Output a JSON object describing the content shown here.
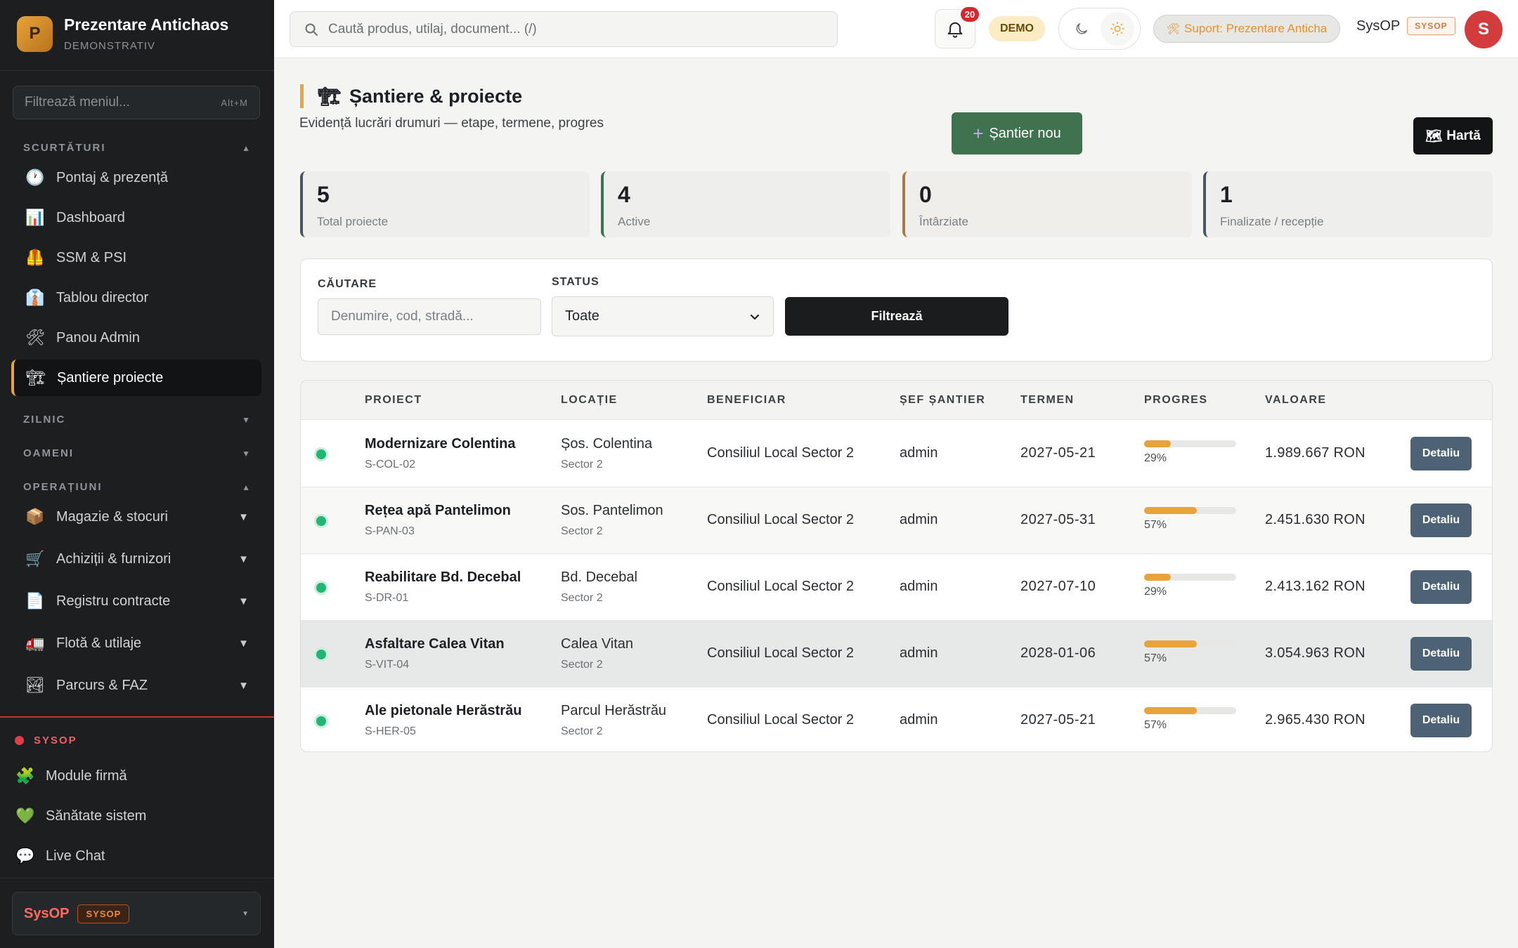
{
  "brand": {
    "logo_letter": "P",
    "name": "Prezentare Antichaos",
    "subtitle": "DEMONSTRATIV"
  },
  "sidebar": {
    "filter_placeholder": "Filtrează meniul...",
    "filter_shortcut": "Alt+M",
    "sections": {
      "shortcuts": "SCURTĂTURI",
      "daily": "ZILNIC",
      "people": "OAMENI",
      "operations": "OPERAȚIUNI"
    },
    "shortcut_items": [
      {
        "label": "Pontaj & prezență",
        "icon": "clock-icon"
      },
      {
        "label": "Dashboard",
        "icon": "bar-chart-icon"
      },
      {
        "label": "SSM & PSI",
        "icon": "safety-vest-icon"
      },
      {
        "label": "Tablou director",
        "icon": "director-icon"
      },
      {
        "label": "Panou Admin",
        "icon": "tools-icon"
      },
      {
        "label": "Șantiere proiecte",
        "icon": "construction-icon"
      }
    ],
    "operation_items": [
      {
        "label": "Magazie & stocuri",
        "icon": "package-icon"
      },
      {
        "label": "Achiziții & furnizori",
        "icon": "cart-icon"
      },
      {
        "label": "Registru contracte",
        "icon": "document-icon"
      },
      {
        "label": "Flotă & utilaje",
        "icon": "truck-icon"
      },
      {
        "label": "Parcurs & FAZ",
        "icon": "route-icon"
      }
    ],
    "sysop_label": "SYSOP",
    "sysop_items": [
      {
        "label": "Module firmă",
        "icon": "puzzle-icon"
      },
      {
        "label": "Sănătate sistem",
        "icon": "heart-icon"
      },
      {
        "label": "Live Chat",
        "icon": "chat-icon"
      }
    ],
    "user": {
      "name": "SysOP",
      "badge": "SYSOP"
    }
  },
  "topbar": {
    "search_placeholder": "Caută produs, utilaj, document... (/)",
    "notifications_count": "20",
    "demo_label": "DEMO",
    "support_label": "Suport: Prezentare Anticha",
    "user_name": "SysOP",
    "user_badge": "SYSOP",
    "avatar_letter": "S"
  },
  "page": {
    "title": "Șantiere & proiecte",
    "subtitle": "Evidență lucrări drumuri — etape, termene, progres",
    "new_button": "Șantier nou",
    "map_button": "Hartă"
  },
  "stats": [
    {
      "value": "5",
      "label": "Total proiecte",
      "color": "#4a5563"
    },
    {
      "value": "4",
      "label": "Active",
      "color": "#3f7350"
    },
    {
      "value": "0",
      "label": "Întârziate",
      "color": "#a77a4a"
    },
    {
      "value": "1",
      "label": "Finalizate / recepție",
      "color": "#4a5563"
    }
  ],
  "filters": {
    "search_label": "CĂUTARE",
    "search_placeholder": "Denumire, cod, stradă...",
    "status_label": "STATUS",
    "status_value": "Toate",
    "button": "Filtrează"
  },
  "table": {
    "headers": [
      "PROIECT",
      "LOCAȚIE",
      "BENEFICIAR",
      "ȘEF ȘANTIER",
      "TERMEN",
      "PROGRES",
      "VALOARE"
    ],
    "detail_label": "Detaliu",
    "rows": [
      {
        "name": "Modernizare Colentina",
        "code": "S-COL-02",
        "location": "Șos. Colentina",
        "sector": "Sector 2",
        "beneficiary": "Consiliul Local Sector 2",
        "manager": "admin",
        "deadline": "2027-05-21",
        "progress": 29,
        "progress_label": "29%",
        "value": "1.989.667 RON"
      },
      {
        "name": "Rețea apă Pantelimon",
        "code": "S-PAN-03",
        "location": "Sos. Pantelimon",
        "sector": "Sector 2",
        "beneficiary": "Consiliul Local Sector 2",
        "manager": "admin",
        "deadline": "2027-05-31",
        "progress": 57,
        "progress_label": "57%",
        "value": "2.451.630 RON"
      },
      {
        "name": "Reabilitare Bd. Decebal",
        "code": "S-DR-01",
        "location": "Bd. Decebal",
        "sector": "Sector 2",
        "beneficiary": "Consiliul Local Sector 2",
        "manager": "admin",
        "deadline": "2027-07-10",
        "progress": 29,
        "progress_label": "29%",
        "value": "2.413.162 RON"
      },
      {
        "name": "Asfaltare Calea Vitan",
        "code": "S-VIT-04",
        "location": "Calea Vitan",
        "sector": "Sector 2",
        "beneficiary": "Consiliul Local Sector 2",
        "manager": "admin",
        "deadline": "2028-01-06",
        "progress": 57,
        "progress_label": "57%",
        "value": "3.054.963 RON"
      },
      {
        "name": "Ale pietonale Herăstrău",
        "code": "S-HER-05",
        "location": "Parcul Herăstrău",
        "sector": "Sector 2",
        "beneficiary": "Consiliul Local Sector 2",
        "manager": "admin",
        "deadline": "2027-05-21",
        "progress": 57,
        "progress_label": "57%",
        "value": "2.965.430 RON"
      }
    ]
  }
}
